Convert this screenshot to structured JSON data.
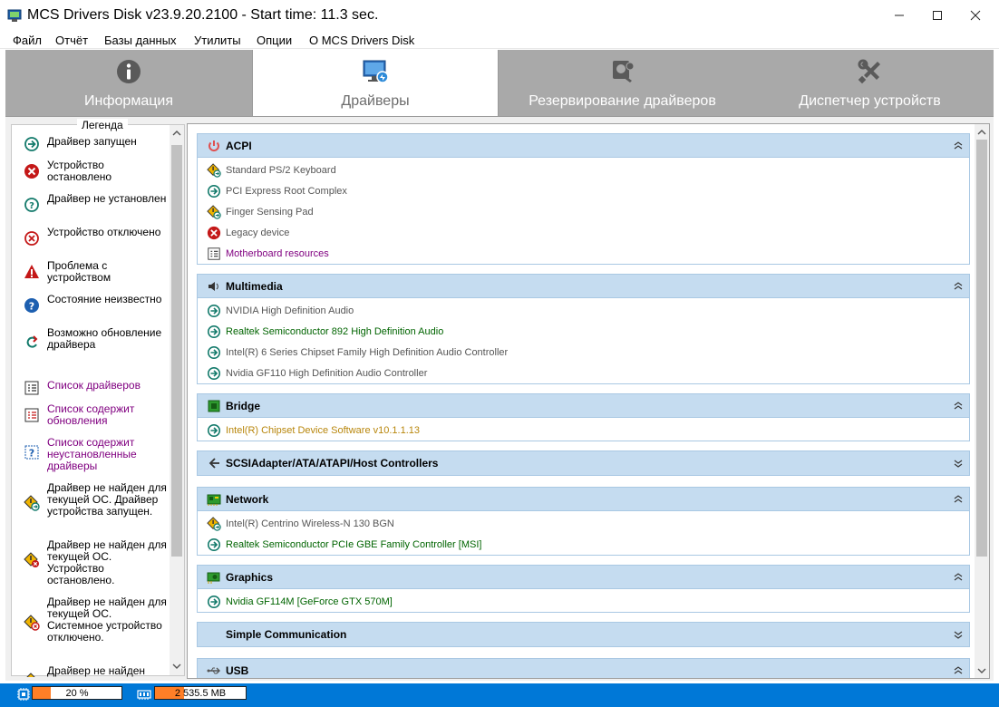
{
  "window": {
    "title": "MCS Drivers Disk v23.9.20.2100 - Start time: 11.3 sec."
  },
  "menu": [
    "Файл",
    "Отчёт",
    "Базы данных",
    "Утилиты",
    "Опции",
    "О MCS Drivers Disk"
  ],
  "tabs": [
    {
      "label": "Информация",
      "icon": "info-icon",
      "active": false
    },
    {
      "label": "Драйверы",
      "icon": "drivers-monitor-icon",
      "active": true
    },
    {
      "label": "Резервирование драйверов",
      "icon": "backup-icon",
      "active": false
    },
    {
      "label": "Диспетчер устройств",
      "icon": "tools-icon",
      "active": false
    }
  ],
  "legend": {
    "title": "Легенда",
    "items": [
      {
        "text": "Драйвер запущен",
        "icon": "running-icon"
      },
      {
        "text": "Устройство остановлено",
        "icon": "stopped-icon"
      },
      {
        "text": "Драйвер не установлен",
        "icon": "not-installed-icon"
      },
      {
        "text": "Устройство отключено",
        "icon": "disabled-icon"
      },
      {
        "text": "Проблема с устройством",
        "icon": "warning-icon"
      },
      {
        "text": "Состояние неизвестно",
        "icon": "unknown-icon"
      },
      {
        "text": "Возможно обновление драйвера",
        "icon": "update-icon"
      },
      {
        "text": "Список драйверов",
        "icon": "list-icon"
      },
      {
        "text": "Список содержит обновления",
        "icon": "list-update-icon"
      },
      {
        "text": "Список содержит неустановленные драйверы",
        "icon": "list-missing-icon"
      },
      {
        "text": "Драйвер не найден для текущей ОС. Драйвер устройства запущен.",
        "icon": "notfound-running-icon"
      },
      {
        "text": "Драйвер не найден для текущей ОС. Устройство остановлено.",
        "icon": "notfound-stopped-icon"
      },
      {
        "text": "Драйвер не найден для текущей ОС. Системное устройство отключено.",
        "icon": "notfound-disabled-icon"
      },
      {
        "text": "Драйвер не найден",
        "icon": "notfound-icon"
      }
    ]
  },
  "groups": [
    {
      "title": "ACPI",
      "icon": "power-icon",
      "expanded": true,
      "drivers": [
        {
          "name": "Standard PS/2 Keyboard",
          "status": "notfound-running-icon",
          "color": "#555555"
        },
        {
          "name": "PCI Express Root Complex",
          "status": "running-icon",
          "color": "#555555"
        },
        {
          "name": "Finger Sensing Pad",
          "status": "notfound-running-icon",
          "color": "#555555"
        },
        {
          "name": "Legacy device",
          "status": "stopped-icon",
          "color": "#555555"
        },
        {
          "name": "Motherboard resources",
          "status": "list-icon",
          "color": "#800080"
        }
      ]
    },
    {
      "title": "Multimedia",
      "icon": "speaker-icon",
      "expanded": true,
      "drivers": [
        {
          "name": "NVIDIA High Definition Audio",
          "status": "running-icon",
          "color": "#555555"
        },
        {
          "name": "Realtek Semiconductor 892 High Definition Audio",
          "status": "running-icon",
          "color": "#006400"
        },
        {
          "name": "Intel(R) 6 Series Chipset Family High Definition Audio Controller",
          "status": "running-icon",
          "color": "#555555"
        },
        {
          "name": "Nvidia GF110 High Definition Audio Controller",
          "status": "running-icon",
          "color": "#555555"
        }
      ]
    },
    {
      "title": "Bridge",
      "icon": "chip-icon",
      "expanded": true,
      "drivers": [
        {
          "name": "Intel(R) Chipset Device Software v10.1.1.13",
          "status": "running-icon",
          "color": "#b8860b"
        }
      ]
    },
    {
      "title": "SCSIAdapter/ATA/ATAPI/Host Controllers",
      "icon": "scsi-icon",
      "expanded": false,
      "drivers": []
    },
    {
      "title": "Network",
      "icon": "network-card-icon",
      "expanded": true,
      "drivers": [
        {
          "name": "Intel(R) Centrino Wireless-N 130 BGN",
          "status": "notfound-running-icon",
          "color": "#555555"
        },
        {
          "name": "Realtek Semiconductor PCIe GBE Family Controller [MSI]",
          "status": "running-icon",
          "color": "#006400"
        }
      ]
    },
    {
      "title": "Graphics",
      "icon": "graphics-card-icon",
      "expanded": true,
      "drivers": [
        {
          "name": "Nvidia GF114M [GeForce GTX 570M]",
          "status": "running-icon",
          "color": "#006400"
        }
      ]
    },
    {
      "title": "Simple Communication",
      "icon": "",
      "expanded": false,
      "drivers": []
    },
    {
      "title": "USB",
      "icon": "usb-icon",
      "expanded": true,
      "drivers": []
    }
  ],
  "status": {
    "cpu": {
      "text": "20 %",
      "level": 0.2,
      "icon": "cpu-icon"
    },
    "memory": {
      "text": "2 535.5 MB",
      "level": 0.32,
      "icon": "memory-icon"
    }
  }
}
